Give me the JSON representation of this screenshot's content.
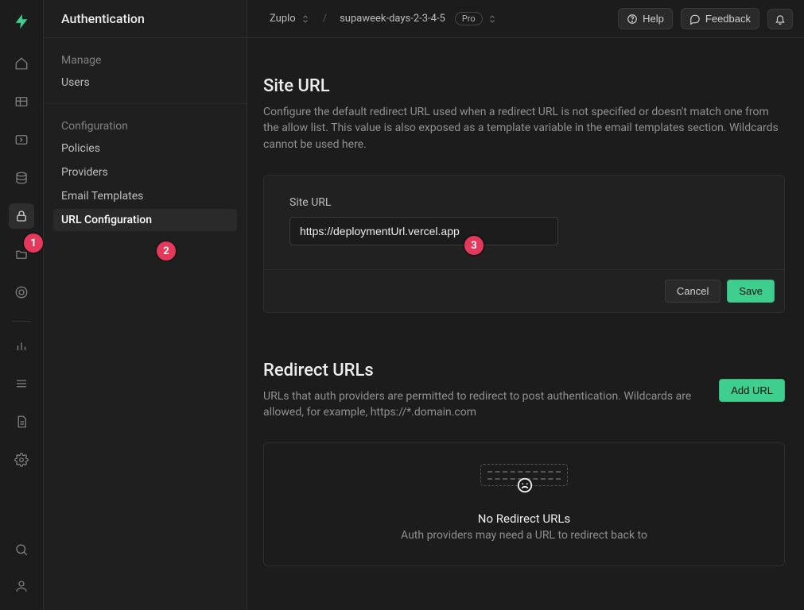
{
  "page_title": "Authentication",
  "breadcrumb": {
    "org": "Zuplo",
    "project": "supaweek-days-2-3-4-5",
    "plan_badge": "Pro"
  },
  "header_buttons": {
    "help": "Help",
    "feedback": "Feedback"
  },
  "sidebar": {
    "sections": [
      {
        "label": "Manage",
        "items": [
          {
            "label": "Users",
            "active": false
          }
        ]
      },
      {
        "label": "Configuration",
        "items": [
          {
            "label": "Policies",
            "active": false
          },
          {
            "label": "Providers",
            "active": false
          },
          {
            "label": "Email Templates",
            "active": false
          },
          {
            "label": "URL Configuration",
            "active": true
          }
        ]
      }
    ]
  },
  "site_url_section": {
    "title": "Site URL",
    "description": "Configure the default redirect URL used when a redirect URL is not specified or doesn't match one from the allow list. This value is also exposed as a template variable in the email templates section. Wildcards cannot be used here.",
    "field_label": "Site URL",
    "field_value": "https://deploymentUrl.vercel.app",
    "cancel_label": "Cancel",
    "save_label": "Save"
  },
  "redirect_section": {
    "title": "Redirect URLs",
    "description": "URLs that auth providers are permitted to redirect to post authentication. Wildcards are allowed, for example, https://*.domain.com",
    "add_button": "Add URL",
    "empty_title": "No Redirect URLs",
    "empty_subtitle": "Auth providers may need a URL to redirect back to"
  },
  "annotations": {
    "pin1": "1",
    "pin2": "2",
    "pin3": "3"
  }
}
